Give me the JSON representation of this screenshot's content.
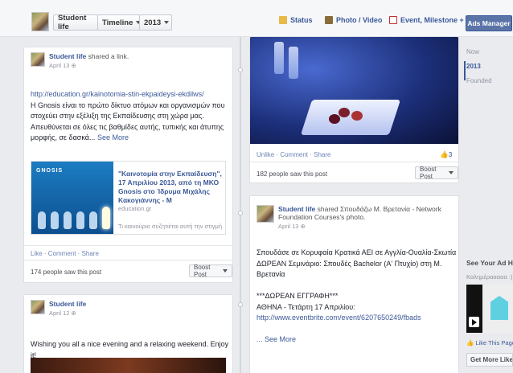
{
  "header": {
    "page_name": "Student life",
    "timeline_label": "Timeline",
    "year_label": "2013",
    "status_label": "Status",
    "photo_video_label": "Photo / Video",
    "event_label": "Event, Milestone +",
    "ads_manager_label": "Ads Manager"
  },
  "post1": {
    "author": "Student life",
    "action": " shared a link.",
    "date": "April 13",
    "url": "http://education.gr/kainotomia-stin-ekpaideysi-ekdilws/",
    "text_lines": [
      "Η Gnosis είναι το πρώτο δίκτυο ατόμων και οργανισμών που",
      "στοχεύει στην εξέλιξη της Εκπαίδευσης στη χώρα μας.",
      "Απευθύνεται σε όλες τις βαθμίδες αυτής, τυπικής και άτυπης",
      "μορφής, σε δασκά..."
    ],
    "see_more": "See More",
    "preview_logo_text": "GNOSIS",
    "preview_title": "\"Καινοτομία στην Εκπαίδευση\", 17 Απριλίου 2013, από τη ΜΚΟ Gnosis στο Ίδρυμα Μιχάλης Κακογιάννης - Μ",
    "preview_domain": "education.gr",
    "preview_sub": "Τι καινούριο συζητιέται αυτή την στιγμή",
    "actions": "Like · Comment · Share",
    "seen": "174 people saw this post",
    "boost": "Boost Post"
  },
  "post2": {
    "author": "Student life",
    "date": "April 12",
    "text": "Wishing you all a nice evening and a relaxing weekend. Enjoy it!"
  },
  "post3": {
    "actions": "Unlike · Comment · Share",
    "likes": "3",
    "seen": "182 people saw this post",
    "boost": "Boost Post"
  },
  "post4": {
    "author": "Student life",
    "action_line1": " shared Σπουδάζω Μ. Βρετανία - Network",
    "action_line2": "Foundation Courses's photo.",
    "date": "April 13",
    "text_lines": [
      "Σπουδάσε σε Κορυφαία Κρατικά ΑΕΙ σε Αγγλία-Ουαλία-Σκωτία",
      "ΔΩΡΕΑΝ Σεμινάριο: Σπουδές Bachelor (Α' Πτυχίο) στη Μ.",
      "Βρετανία",
      "",
      "***ΔΩΡΕΑΝ ΕΓΓΡΑΦΗ***",
      "ΑΘΗΝΑ - Τετάρτη 17 Απριλίου:"
    ],
    "url": "http://www.eventbrite.com/event/6207650249/fbads",
    "see_more": "... See More"
  },
  "rail": {
    "years": [
      "Now",
      "2013",
      "Founded"
    ],
    "ad_heading": "See Your Ad Her",
    "ad_sub": "Καλημέρααααα :)))",
    "like_page": "Like This Page",
    "get_more": "Get More Likes"
  },
  "colors": {
    "accent": "#3b5998",
    "ads_button": "#5b74a8"
  }
}
